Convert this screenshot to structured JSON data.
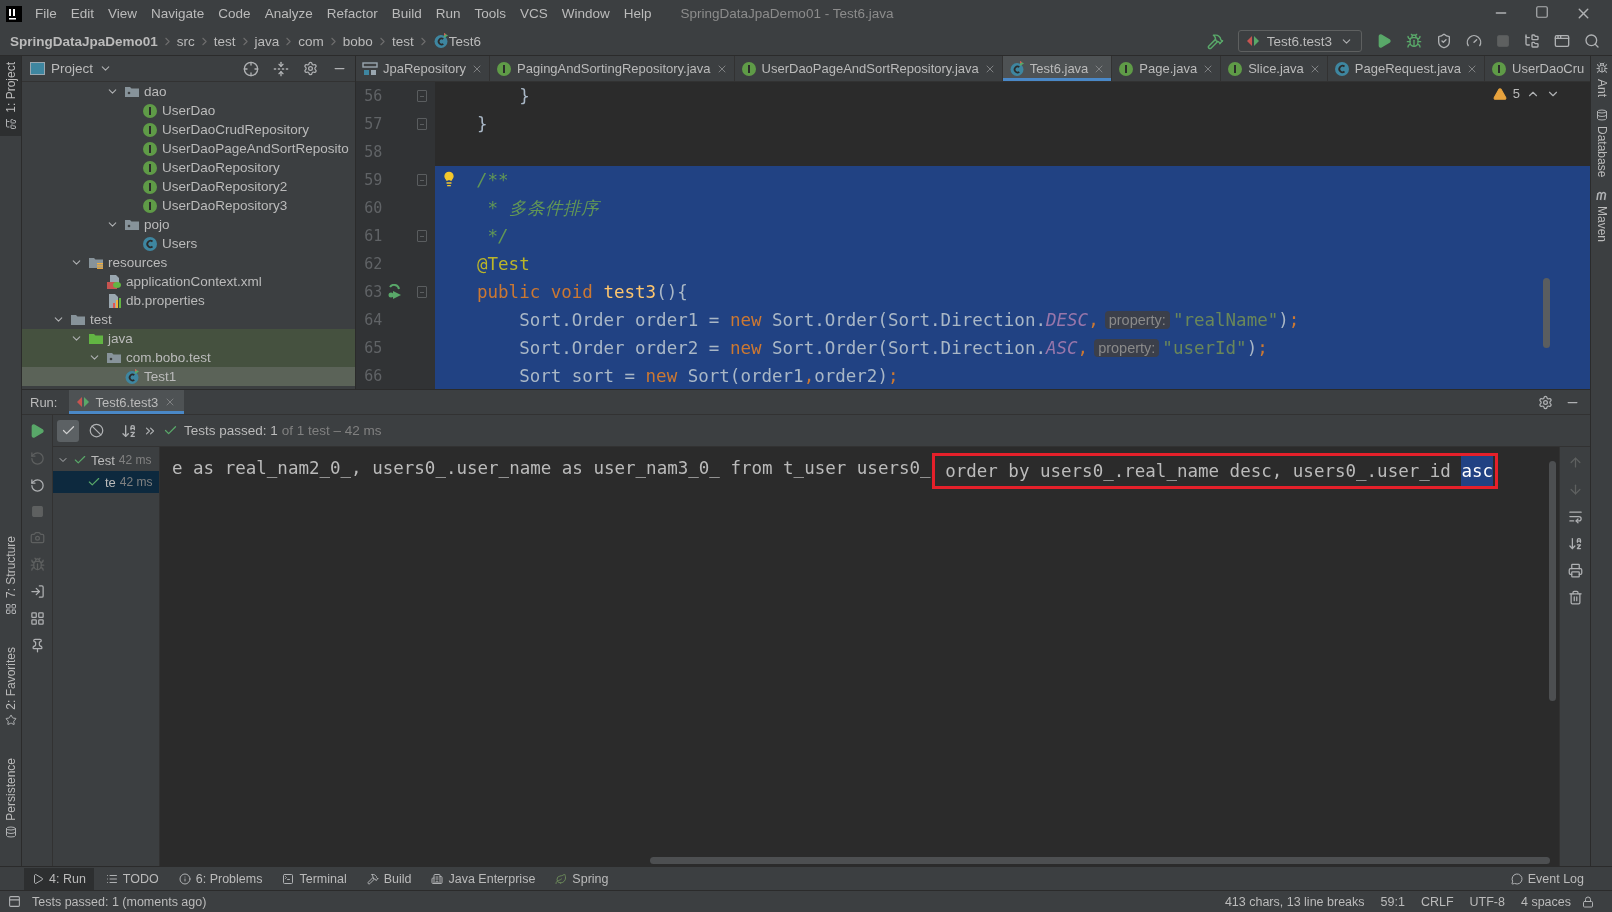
{
  "window": {
    "title": "SpringDataJpaDemo01 - Test6.java"
  },
  "menu": [
    "File",
    "Edit",
    "View",
    "Navigate",
    "Code",
    "Analyze",
    "Refactor",
    "Build",
    "Run",
    "Tools",
    "VCS",
    "Window",
    "Help"
  ],
  "breadcrumbs": [
    {
      "label": "SpringDataJpaDemo01",
      "kind": "project"
    },
    {
      "label": "src",
      "kind": "dir"
    },
    {
      "label": "test",
      "kind": "dir"
    },
    {
      "label": "java",
      "kind": "dir"
    },
    {
      "label": "com",
      "kind": "dir"
    },
    {
      "label": "bobo",
      "kind": "dir"
    },
    {
      "label": "test",
      "kind": "dir"
    },
    {
      "label": "Test6",
      "kind": "test-class"
    }
  ],
  "run_config": "Test6.test3",
  "left_stripe": {
    "top": [
      {
        "label": "1: Project",
        "selected": true
      }
    ],
    "bottom": [
      {
        "label": "7: Structure",
        "selected": false
      },
      {
        "label": "2: Favorites",
        "selected": false
      },
      {
        "label": "Persistence",
        "selected": false
      }
    ]
  },
  "right_stripe": [
    {
      "label": "Ant",
      "kind": "ant"
    },
    {
      "label": "Database",
      "kind": "database"
    },
    {
      "label": "Maven",
      "kind": "maven"
    }
  ],
  "project_panel": {
    "title": "Project",
    "tree": [
      {
        "children": [
          {
            "children": [
              {
                "children": [
                  {
                    "label": "dao",
                    "kind": "package",
                    "expanded": true,
                    "selected": false,
                    "test_scope": false,
                    "children": [
                      {
                        "label": "UserDao",
                        "kind": "interface",
                        "selected": false,
                        "test_scope": false
                      },
                      {
                        "label": "UserDaoCrudRepository",
                        "kind": "interface",
                        "selected": false,
                        "test_scope": false
                      },
                      {
                        "label": "UserDaoPageAndSortReposito",
                        "kind": "interface",
                        "selected": false,
                        "test_scope": false
                      },
                      {
                        "label": "UserDaoRepository",
                        "kind": "interface",
                        "selected": false,
                        "test_scope": false
                      },
                      {
                        "label": "UserDaoRepository2",
                        "kind": "interface",
                        "selected": false,
                        "test_scope": false
                      },
                      {
                        "label": "UserDaoRepository3",
                        "kind": "interface",
                        "selected": false,
                        "test_scope": false
                      }
                    ]
                  },
                  {
                    "label": "pojo",
                    "kind": "package",
                    "expanded": true,
                    "selected": false,
                    "test_scope": false,
                    "children": [
                      {
                        "label": "Users",
                        "kind": "class",
                        "selected": false,
                        "test_scope": false
                      }
                    ]
                  }
                ]
              }
            ]
          },
          {
            "label": "resources",
            "kind": "resources",
            "expanded": true,
            "selected": false,
            "test_scope": false,
            "children": [
              {
                "label": "applicationContext.xml",
                "kind": "xml",
                "selected": false,
                "test_scope": false
              },
              {
                "label": "db.properties",
                "kind": "properties",
                "selected": false,
                "test_scope": false
              }
            ]
          }
        ]
      },
      {
        "label": "test",
        "kind": "folder",
        "expanded": true,
        "selected": false,
        "test_scope": false,
        "children": [
          {
            "label": "java",
            "kind": "test-source",
            "expanded": true,
            "selected": false,
            "test_scope": true,
            "children": [
              {
                "label": "com.bobo.test",
                "kind": "package",
                "expanded": true,
                "selected": false,
                "test_scope": true,
                "children": [
                  {
                    "label": "Test1",
                    "kind": "test-class",
                    "selected": true,
                    "test_scope": true
                  }
                ]
              }
            ]
          }
        ]
      }
    ]
  },
  "editor": {
    "tabs": [
      {
        "label": "JpaRepository",
        "kind": "repository",
        "selected": false,
        "closable": true
      },
      {
        "label": "PagingAndSortingRepository.java",
        "kind": "interface",
        "selected": false,
        "closable": true
      },
      {
        "label": "UserDaoPageAndSortRepository.java",
        "kind": "interface",
        "selected": false,
        "closable": true
      },
      {
        "label": "Test6.java",
        "kind": "test-class",
        "selected": true,
        "closable": true
      },
      {
        "label": "Page.java",
        "kind": "interface",
        "selected": false,
        "closable": true
      },
      {
        "label": "Slice.java",
        "kind": "interface",
        "selected": false,
        "closable": true
      },
      {
        "label": "PageRequest.java",
        "kind": "class",
        "selected": false,
        "closable": true
      },
      {
        "label": "UserDaoCru",
        "kind": "interface",
        "selected": false,
        "closable": false
      }
    ],
    "warnings": "5",
    "lines": [
      {
        "number": "56",
        "selected": false,
        "fold": true,
        "intention": false,
        "runnable": false,
        "tokens": [
          {
            "kind": "plain",
            "text": "    }"
          }
        ]
      },
      {
        "number": "57",
        "selected": false,
        "fold": true,
        "intention": false,
        "runnable": false,
        "tokens": [
          {
            "kind": "plain",
            "text": "}"
          }
        ]
      },
      {
        "number": "58",
        "selected": false,
        "fold": false,
        "intention": false,
        "runnable": false
      },
      {
        "number": "59",
        "selected": true,
        "fold": true,
        "intention": true,
        "runnable": false,
        "tokens": [
          {
            "kind": "comment",
            "text": "/**"
          }
        ]
      },
      {
        "number": "60",
        "selected": true,
        "fold": false,
        "intention": false,
        "runnable": false,
        "tokens": [
          {
            "kind": "comment",
            "text": " * 多条件排序"
          }
        ]
      },
      {
        "number": "61",
        "selected": true,
        "fold": true,
        "intention": false,
        "runnable": false,
        "tokens": [
          {
            "kind": "comment",
            "text": " */"
          }
        ]
      },
      {
        "number": "62",
        "selected": true,
        "fold": false,
        "intention": false,
        "runnable": false,
        "tokens": [
          {
            "kind": "annotation",
            "text": "@Test"
          }
        ]
      },
      {
        "number": "63",
        "selected": true,
        "fold": true,
        "intention": false,
        "runnable": true,
        "tokens": [
          {
            "kind": "keyword",
            "text": "public void"
          },
          {
            "kind": "method",
            "text": " test3"
          },
          {
            "kind": "plain",
            "text": "(){"
          }
        ]
      },
      {
        "number": "64",
        "selected": true,
        "fold": false,
        "intention": false,
        "runnable": false,
        "tokens": [
          {
            "kind": "plain",
            "text": "    Sort.Order order1 = "
          },
          {
            "kind": "keyword",
            "text": "new"
          },
          {
            "kind": "plain",
            "text": " Sort.Order(Sort.Direction."
          },
          {
            "kind": "constant",
            "text": "DESC"
          },
          {
            "kind": "punct",
            "text": ","
          },
          {
            "kind": "hint",
            "text": "property:"
          },
          {
            "kind": "string",
            "text": "\"realName\""
          },
          {
            "kind": "plain",
            "text": ")"
          },
          {
            "kind": "punct",
            "text": ";"
          }
        ]
      },
      {
        "number": "65",
        "selected": true,
        "fold": false,
        "intention": false,
        "runnable": false,
        "tokens": [
          {
            "kind": "plain",
            "text": "    Sort.Order order2 = "
          },
          {
            "kind": "keyword",
            "text": "new"
          },
          {
            "kind": "plain",
            "text": " Sort.Order(Sort.Direction."
          },
          {
            "kind": "constant",
            "text": "ASC"
          },
          {
            "kind": "punct",
            "text": ","
          },
          {
            "kind": "hint",
            "text": "property:"
          },
          {
            "kind": "string",
            "text": "\"userId\""
          },
          {
            "kind": "plain",
            "text": ")"
          },
          {
            "kind": "punct",
            "text": ";"
          }
        ]
      },
      {
        "number": "66",
        "selected": true,
        "fold": false,
        "intention": false,
        "runnable": false,
        "tokens": [
          {
            "kind": "plain",
            "text": "    Sort sort = "
          },
          {
            "kind": "keyword",
            "text": "new"
          },
          {
            "kind": "plain",
            "text": " Sort(order1"
          },
          {
            "kind": "punct",
            "text": ","
          },
          {
            "kind": "plain",
            "text": "order2)"
          },
          {
            "kind": "punct",
            "text": ";"
          }
        ]
      }
    ]
  },
  "run": {
    "label": "Run:",
    "tab": "Test6.test3",
    "status": "Tests passed: 1",
    "status_detail": "of 1 test – 42 ms",
    "filters": [
      {
        "kind": "passed",
        "on": true
      },
      {
        "kind": "ignored",
        "on": false
      }
    ],
    "tests": [
      {
        "name": "Test",
        "duration": "42 ms",
        "expanded": true,
        "selected": false,
        "children": [
          {
            "name": "te",
            "duration": "42 ms",
            "selected": true
          }
        ]
      }
    ],
    "console": {
      "text": "e as real_nam2_0_, users0_.user_name as user_nam3_0_ from t_user users0_",
      "highlight": [
        {
          "text": " order by users0_.real_name desc, users0_.user_id ",
          "selected": false
        },
        {
          "text": "asc",
          "selected": true
        }
      ]
    }
  },
  "bottom_tabs": [
    {
      "label": "4: Run",
      "kind": "run",
      "selected": true
    },
    {
      "label": "TODO",
      "kind": "todo",
      "selected": false
    },
    {
      "label": "6: Problems",
      "kind": "problems",
      "selected": false
    },
    {
      "label": "Terminal",
      "kind": "terminal",
      "selected": false
    },
    {
      "label": "Build",
      "kind": "build",
      "selected": false
    },
    {
      "label": "Java Enterprise",
      "kind": "enterprise",
      "selected": false
    },
    {
      "label": "Spring",
      "kind": "spring",
      "selected": false
    }
  ],
  "event_log": "Event Log",
  "status_bar": {
    "message": "Tests passed: 1 (moments ago)",
    "items": [
      "413 chars, 13 line breaks",
      "59:1",
      "CRLF",
      "UTF-8",
      "4 spaces"
    ]
  }
}
